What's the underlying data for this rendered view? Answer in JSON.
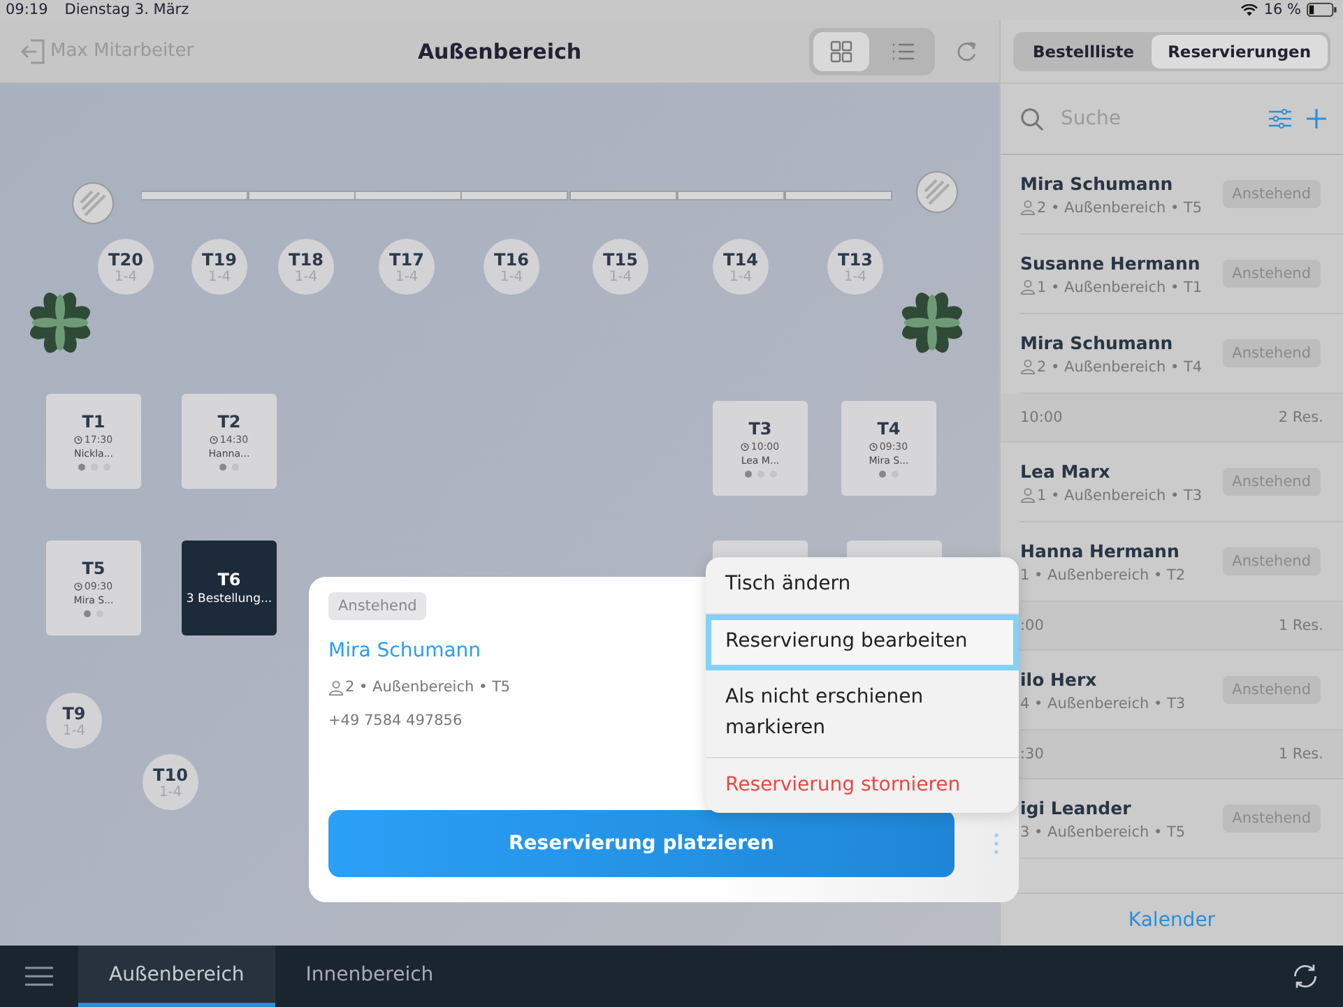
{
  "status_bar": {
    "time": "09:19",
    "date": "Dienstag 3. März",
    "battery": "16 %"
  },
  "nav": {
    "user": "Max Mitarbeiter",
    "title": "Außenbereich",
    "views": [
      {
        "kind": "grid",
        "selected": true
      },
      {
        "kind": "list",
        "selected": false
      }
    ]
  },
  "floor": {
    "tables": [
      {
        "kind": "round",
        "label": "T20",
        "seats": "1-4"
      },
      {
        "kind": "round",
        "label": "T19",
        "seats": "1-4"
      },
      {
        "kind": "round",
        "label": "T18",
        "seats": "1-4"
      },
      {
        "kind": "round",
        "label": "T17",
        "seats": "1-4"
      },
      {
        "kind": "round",
        "label": "T16",
        "seats": "1-4"
      },
      {
        "kind": "round",
        "label": "T15",
        "seats": "1-4"
      },
      {
        "kind": "round",
        "label": "T14",
        "seats": "1-4"
      },
      {
        "kind": "round",
        "label": "T13",
        "seats": "1-4"
      },
      {
        "kind": "square",
        "label": "T1",
        "time": "17:30",
        "guest": "Nickla...",
        "dots": [
          {
            "filled": true
          },
          {
            "filled": false
          },
          {
            "filled": false
          }
        ]
      },
      {
        "kind": "square",
        "label": "T2",
        "time": "14:30",
        "guest": "Hanna...",
        "dots": [
          {
            "filled": true
          },
          {
            "filled": false
          }
        ]
      },
      {
        "kind": "square",
        "label": "T3",
        "time": "10:00",
        "guest": "Lea M...",
        "dots": [
          {
            "filled": true
          },
          {
            "filled": false
          },
          {
            "filled": false
          }
        ]
      },
      {
        "kind": "square",
        "label": "T4",
        "time": "09:30",
        "guest": "Mira S...",
        "dots": [
          {
            "filled": true
          },
          {
            "filled": false
          }
        ]
      },
      {
        "kind": "square",
        "label": "T5",
        "time": "09:30",
        "guest": "Mira S...",
        "dots": [
          {
            "filled": true
          },
          {
            "filled": false
          }
        ]
      },
      {
        "kind": "busy",
        "label": "T6",
        "note": "3 Bestellung..."
      },
      {
        "kind": "covered"
      },
      {
        "kind": "covered"
      },
      {
        "kind": "round",
        "label": "T9",
        "seats": "1-4"
      },
      {
        "kind": "round",
        "label": "T10",
        "seats": "1-4"
      }
    ]
  },
  "sidebar": {
    "tabs": [
      {
        "label": "Bestellliste",
        "selected": false
      },
      {
        "label": "Reservierungen",
        "selected": true
      }
    ],
    "search": {
      "placeholder": "Suche"
    },
    "items": [
      {
        "kind": "reservation",
        "name": "Mira Schumann",
        "meta": "2 • Außenbereich • T5",
        "person_icon": true,
        "status": "Anstehend"
      },
      {
        "kind": "reservation",
        "name": "Susanne Hermann",
        "meta": "1 • Außenbereich • T1",
        "person_icon": true,
        "status": "Anstehend"
      },
      {
        "kind": "reservation",
        "name": "Mira Schumann",
        "meta": "2 • Außenbereich • T4",
        "person_icon": true,
        "status": "Anstehend"
      },
      {
        "kind": "header",
        "time": "10:00",
        "count": "2 Res."
      },
      {
        "kind": "reservation",
        "name": "Lea Marx",
        "meta": "1 • Außenbereich • T3",
        "person_icon": true,
        "status": "Anstehend"
      },
      {
        "kind": "reservation",
        "name": "Hanna Hermann",
        "meta": "1 • Außenbereich • T2",
        "person_icon": false,
        "status": "Anstehend"
      },
      {
        "kind": "header",
        "time": ":00",
        "count": "1 Res."
      },
      {
        "kind": "reservation",
        "name": "ilo Herx",
        "meta": "4 • Außenbereich • T3",
        "person_icon": false,
        "status": "Anstehend"
      },
      {
        "kind": "header",
        "time": ":30",
        "count": "1 Res."
      },
      {
        "kind": "reservation",
        "name": "igi Leander",
        "meta": "3 • Außenbereich • T5",
        "person_icon": false,
        "status": "Anstehend"
      }
    ],
    "footer": "Kalender"
  },
  "popup": {
    "status": "Anstehend",
    "name": "Mira Schumann",
    "meta": "2 • Außenbereich • T5",
    "phone": "+49 7584 497856",
    "action": "Reservierung platzieren"
  },
  "menu": [
    {
      "kind": "normal",
      "label": "Tisch ändern",
      "selected": false
    },
    {
      "kind": "normal",
      "label": "Reservierung bearbeiten",
      "selected": true
    },
    {
      "kind": "normal",
      "label": "Als nicht erschienen markieren",
      "selected": false
    },
    {
      "kind": "destructive",
      "label": "Reservierung stornieren",
      "selected": false
    }
  ],
  "bottom_tabs": [
    {
      "label": "Außenbereich",
      "selected": true
    },
    {
      "label": "Innenbereich",
      "selected": false
    }
  ]
}
